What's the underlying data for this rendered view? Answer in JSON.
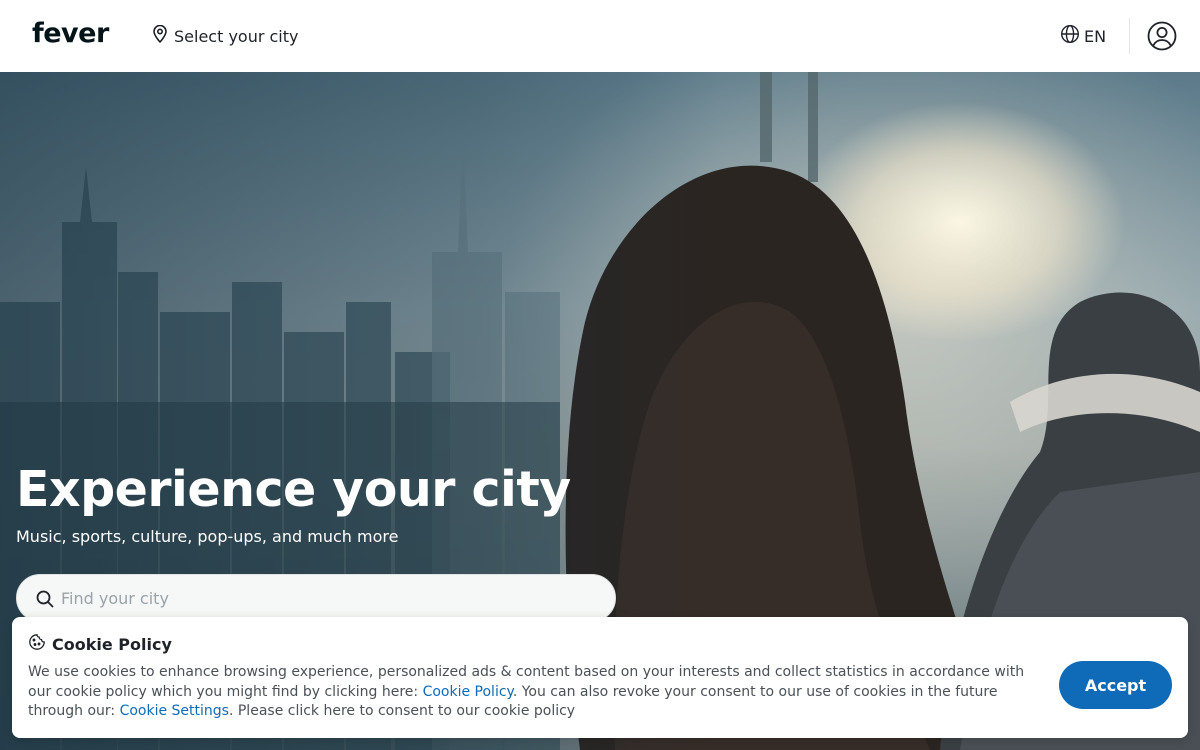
{
  "header": {
    "logo": "fever",
    "city_select_label": "Select your city",
    "language": "EN"
  },
  "hero": {
    "title": "Experience your city",
    "subtitle": "Music, sports, culture, pop-ups, and much more",
    "search_placeholder": "Find your city"
  },
  "cookie": {
    "title": "Cookie Policy",
    "text_part1": "We use cookies to enhance browsing experience, personalized ads & content based on your interests and collect statistics in accordance with our cookie policy which you might find by clicking here: ",
    "link_policy": "Cookie Policy",
    "text_part2": ". You can also revoke your consent to our use of cookies in the future through our: ",
    "link_settings": "Cookie Settings",
    "text_part3": ". Please click here to consent to our cookie policy",
    "accept_label": "Accept"
  },
  "colors": {
    "brand_dark": "#031419",
    "accent_blue": "#0f6bb8",
    "text_primary": "#1f2329",
    "text_secondary": "#4a5157"
  },
  "icons": {
    "city_select": "location-pin-icon",
    "language": "globe-icon",
    "user": "user-icon",
    "search": "search-icon",
    "cookie": "cookie-icon"
  }
}
